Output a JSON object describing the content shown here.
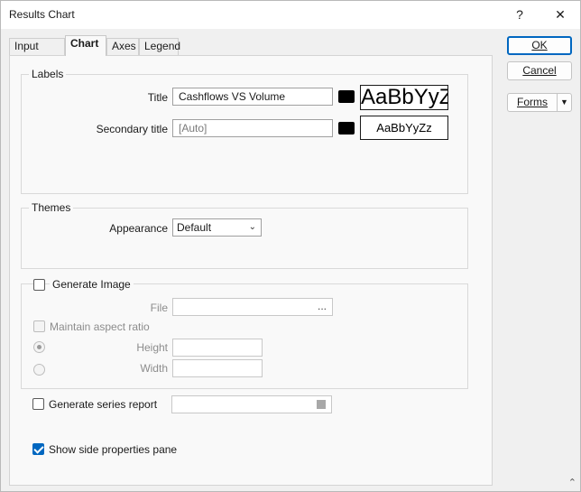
{
  "window": {
    "title": "Results Chart"
  },
  "titlebar": {
    "help": "?",
    "close": "✕"
  },
  "tabs": [
    {
      "label": "Input Data",
      "active": false
    },
    {
      "label": "Chart",
      "active": true
    },
    {
      "label": "Axes",
      "active": false
    },
    {
      "label": "Legend",
      "active": false
    }
  ],
  "labels_group": {
    "heading": "Labels",
    "title_label": "Title",
    "title_value": "Cashflows VS Volume",
    "title_preview": "AaBbYyZz",
    "secondary_label": "Secondary title",
    "secondary_value": "[Auto]",
    "secondary_preview": "AaBbYyZz",
    "swatch_color": "#000000"
  },
  "themes_group": {
    "heading": "Themes",
    "appearance_label": "Appearance",
    "appearance_value": "Default"
  },
  "image_group": {
    "generate_label": "Generate Image",
    "generate_checked": false,
    "file_label": "File",
    "file_button": "...",
    "maintain_label": "Maintain aspect ratio",
    "height_label": "Height",
    "width_label": "Width"
  },
  "series_report": {
    "label": "Generate series report",
    "checked": false
  },
  "side_pane": {
    "label": "Show side properties pane",
    "checked": true
  },
  "buttons": {
    "ok": "OK",
    "cancel": "Cancel",
    "forms": "Forms"
  },
  "colors": {
    "accent": "#0067c0"
  }
}
